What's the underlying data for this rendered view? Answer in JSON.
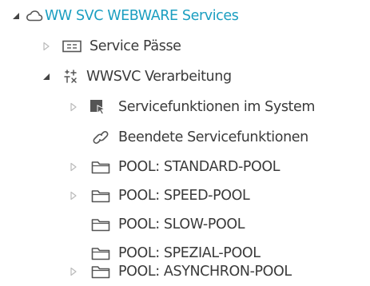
{
  "tree": {
    "root": {
      "label": "WW SVC WEBWARE Services",
      "icon": "cloud-icon",
      "expanded": true,
      "accent": "#1a9ec0"
    },
    "service_passe": {
      "label": "Service Pässe",
      "icon": "id-card-icon",
      "expanded": false
    },
    "verarbeitung": {
      "label": "WWSVC Verarbeitung",
      "icon": "process-icon",
      "expanded": true
    },
    "children": [
      {
        "label": "Servicefunktionen im System",
        "icon": "service-function-icon",
        "has_children": true
      },
      {
        "label": "Beendete Servicefunktionen",
        "icon": "finished-icon",
        "has_children": false
      },
      {
        "label": "POOL: STANDARD-POOL",
        "icon": "folder-icon",
        "has_children": true
      },
      {
        "label": "POOL: SPEED-POOL",
        "icon": "folder-icon",
        "has_children": true
      },
      {
        "label": "POOL: SLOW-POOL",
        "icon": "folder-icon",
        "has_children": false
      },
      {
        "label": "POOL: SPEZIAL-POOL",
        "icon": "folder-icon",
        "has_children": false
      },
      {
        "label": "POOL: ASYNCHRON-POOL",
        "icon": "folder-icon",
        "has_children": true
      }
    ]
  }
}
